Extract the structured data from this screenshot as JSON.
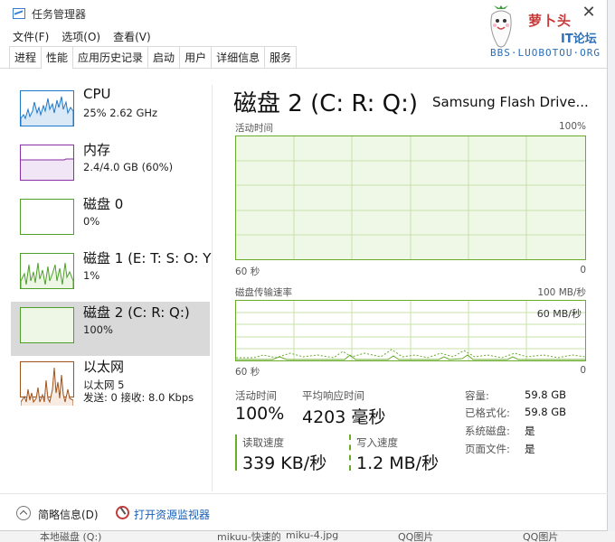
{
  "window": {
    "title": "任务管理器",
    "close_glyph": "✕"
  },
  "logo": {
    "line1": "萝卜头",
    "line2": "IT论坛",
    "line3": "BBS·LUOBOTOU·ORG"
  },
  "menu": [
    "文件(F)",
    "选项(O)",
    "查看(V)"
  ],
  "tabs": [
    "进程",
    "性能",
    "应用历史记录",
    "启动",
    "用户",
    "详细信息",
    "服务"
  ],
  "active_tab": "性能",
  "sidebar": [
    {
      "title": "CPU",
      "sub": "25%  2.62 GHz",
      "sub2": "",
      "color": "#1f78c8"
    },
    {
      "title": "内存",
      "sub": "2.4/4.0 GB (60%)",
      "sub2": "",
      "color": "#8b2fa6"
    },
    {
      "title": "磁盘 0",
      "sub": "0%",
      "sub2": "",
      "color": "#4da02a"
    },
    {
      "title": "磁盘 1 (E: T: S: O: Y",
      "sub": "1%",
      "sub2": "",
      "color": "#4da02a"
    },
    {
      "title": "磁盘 2 (C: R: Q:)",
      "sub": "100%",
      "sub2": "",
      "color": "#4da02a"
    },
    {
      "title": "以太网",
      "sub": "以太网 5",
      "sub2": "发送: 0 接收: 8.0 Kbps",
      "color": "#a0521c"
    }
  ],
  "main": {
    "title": "磁盘 2 (C: R: Q:)",
    "device": "Samsung Flash Drive...",
    "chart1": {
      "label": "活动时间",
      "max": "100%",
      "x_left": "60 秒",
      "x_right": "0"
    },
    "chart2": {
      "label": "磁盘传输速率",
      "max": "100 MB/秒",
      "inner": "60 MB/秒",
      "x_left": "60 秒",
      "x_right": "0"
    },
    "stats": {
      "active_label": "活动时间",
      "active_value": "100%",
      "resp_label": "平均响应时间",
      "resp_value": "4203 毫秒",
      "read_label": "读取速度",
      "read_value": "339 KB/秒",
      "write_label": "写入速度",
      "write_value": "1.2 MB/秒"
    },
    "props": [
      {
        "key": "容量:",
        "value": "59.8 GB"
      },
      {
        "key": "已格式化:",
        "value": "59.8 GB"
      },
      {
        "key": "系统磁盘:",
        "value": "是"
      },
      {
        "key": "页面文件:",
        "value": "是"
      }
    ]
  },
  "footer": {
    "fewer": "简略信息(D)",
    "monitor": "打开资源监视器"
  },
  "background_strip": [
    "本地磁盘 (Q:)",
    "mikuu-快速的",
    "miku-4.jpg",
    "QQ图片",
    "QQ图片"
  ],
  "colors": {
    "disk_green": "#6aab2c",
    "fill_green": "#eff7e6",
    "selected_bg": "#d9d9d9",
    "link_blue": "#1a5fb4"
  }
}
